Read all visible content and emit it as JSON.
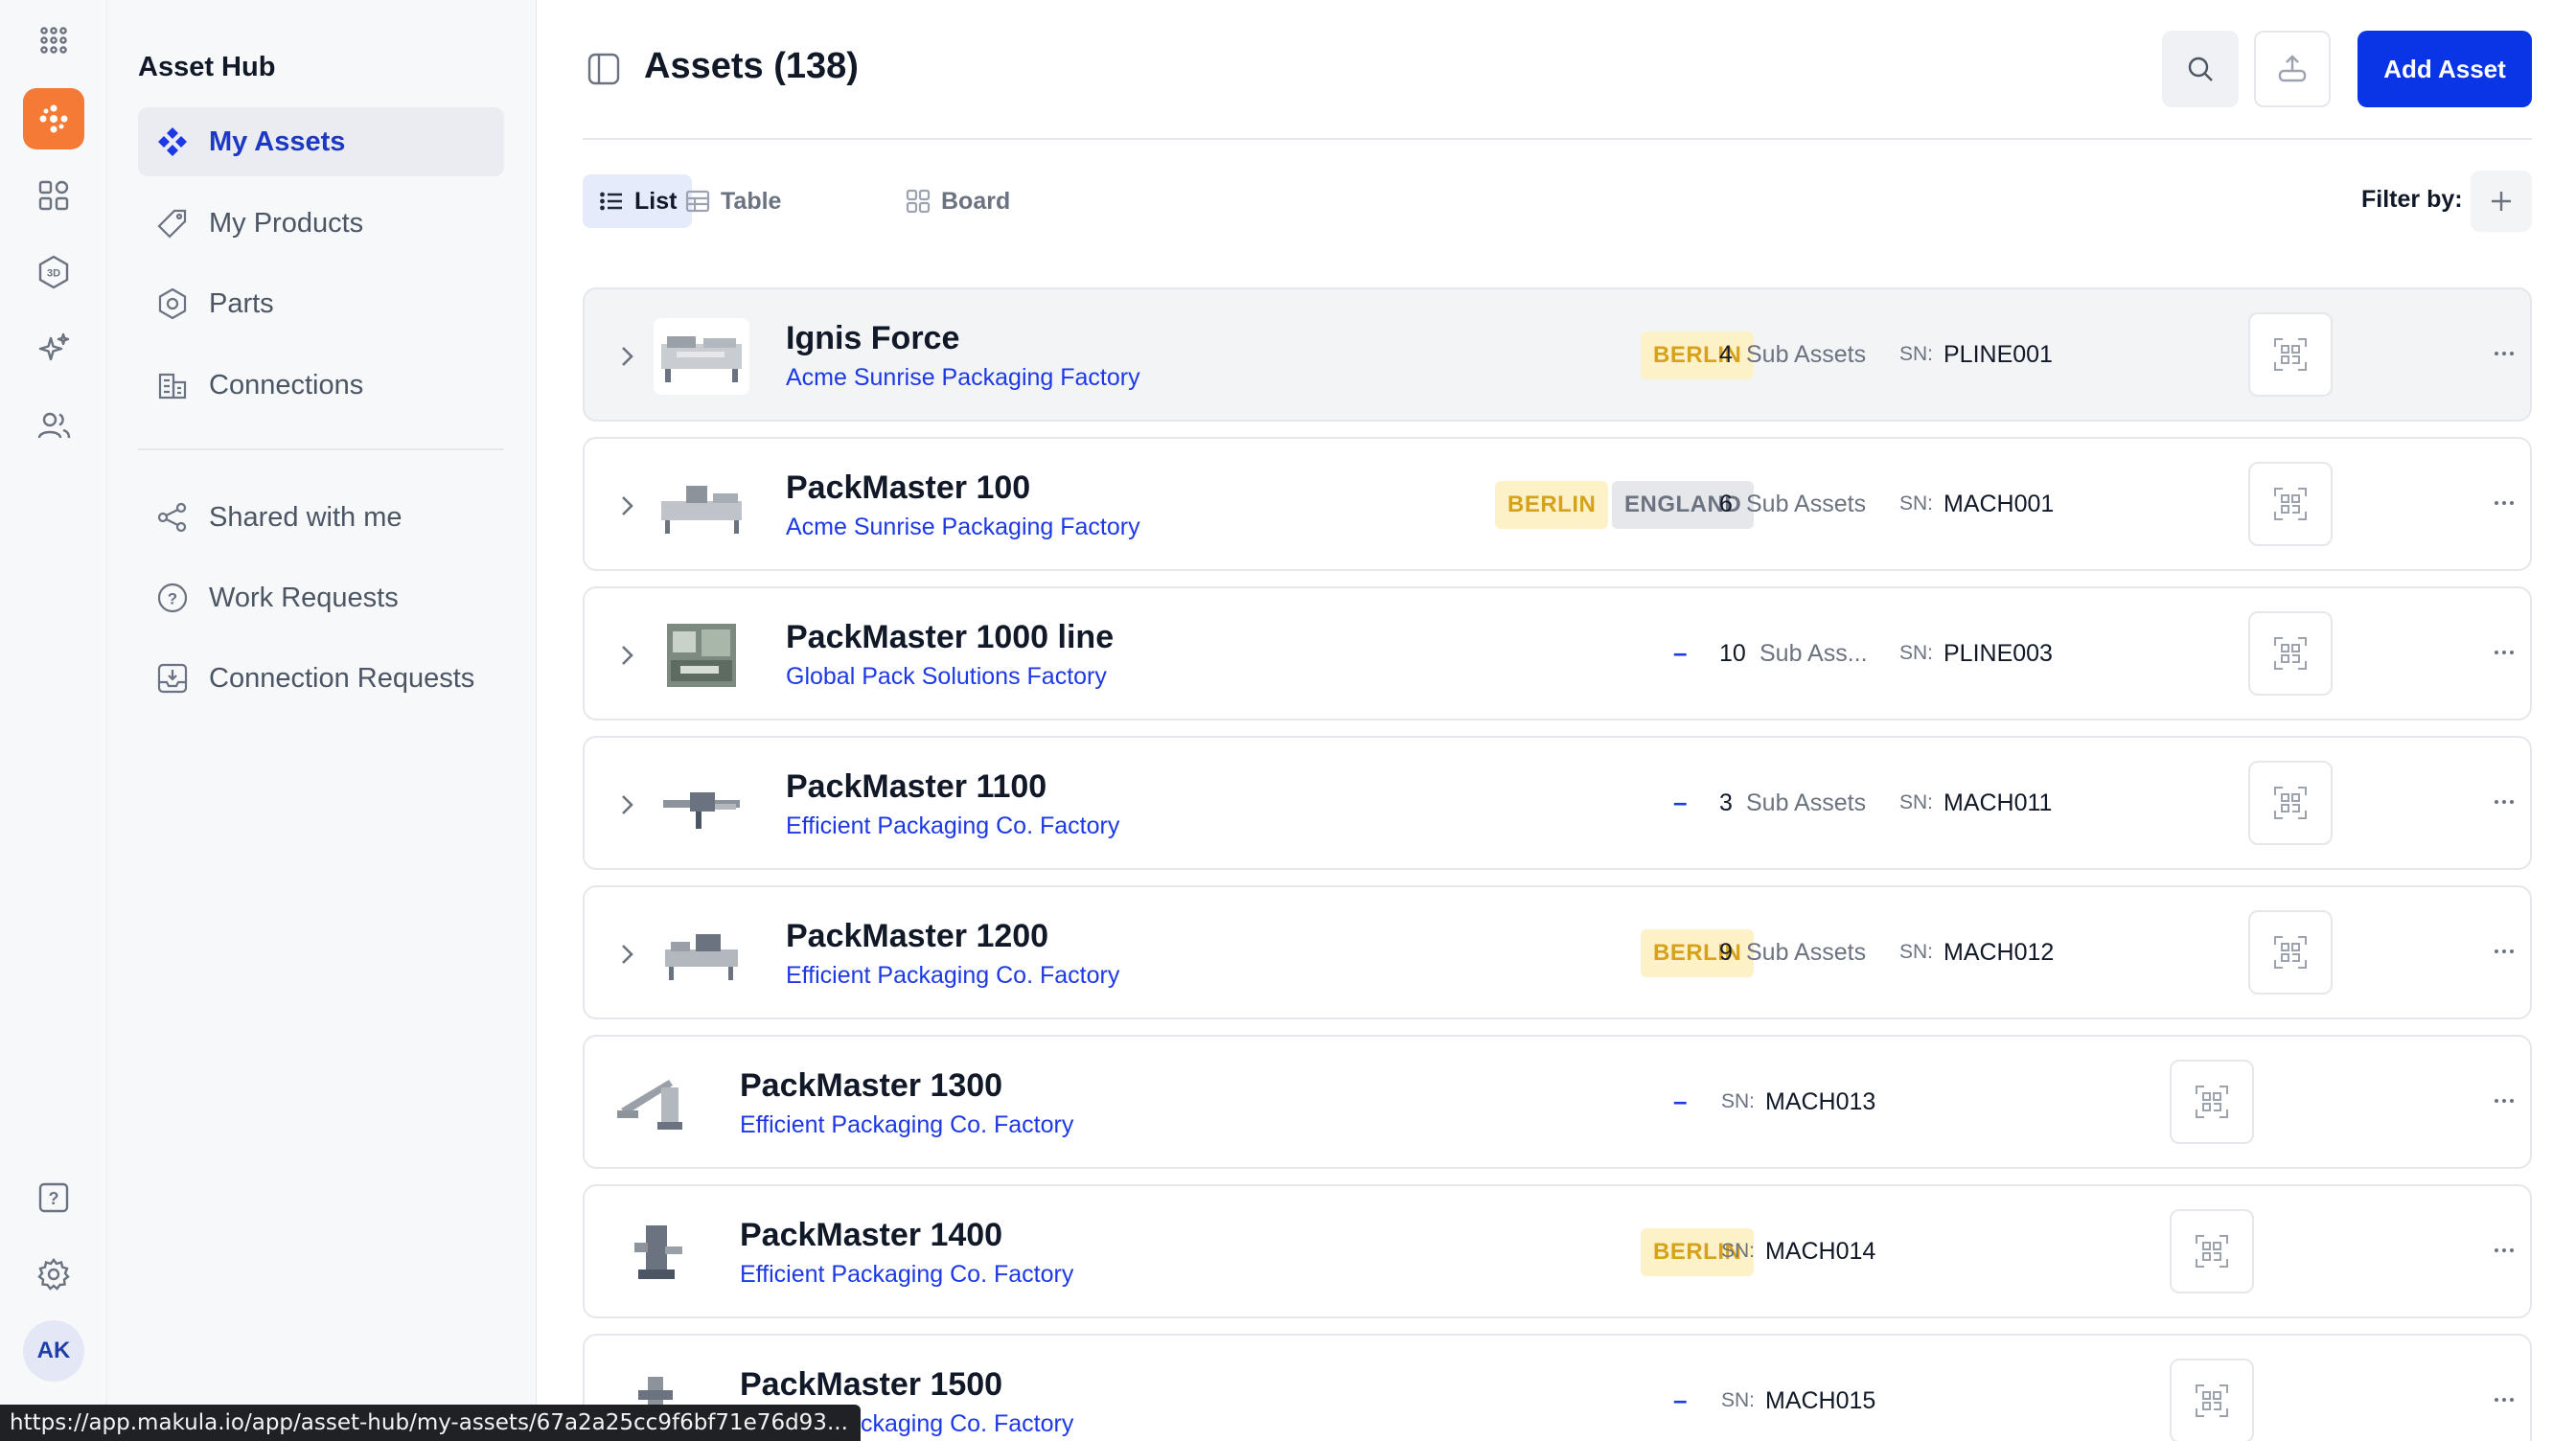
{
  "rail": {
    "items": [
      "apps-grid-icon",
      "asset-hub-icon",
      "widgets-icon",
      "3d-icon",
      "sparkles-icon",
      "users-icon",
      "help-icon",
      "settings-icon"
    ],
    "avatar": "AK",
    "accent": "#f47a36"
  },
  "sidebar": {
    "title": "Asset Hub",
    "items": [
      {
        "label": "My Assets",
        "icon": "diamonds-icon",
        "active": true
      },
      {
        "label": "My Products",
        "icon": "tag-icon"
      },
      {
        "label": "Parts",
        "icon": "hexagon-icon"
      },
      {
        "label": "Connections",
        "icon": "building-icon"
      },
      {
        "label": "Shared with me",
        "icon": "share-icon"
      },
      {
        "label": "Work Requests",
        "icon": "question-icon"
      },
      {
        "label": "Connection Requests",
        "icon": "inbox-icon"
      }
    ]
  },
  "header": {
    "title": "Assets (138)",
    "add_label": "Add Asset",
    "accent": "#0a35e6"
  },
  "views": {
    "tabs": [
      "List",
      "Table",
      "Board"
    ],
    "active": "List",
    "filter_label": "Filter by:"
  },
  "assets": [
    {
      "name": "Ignis Force",
      "location": "Acme Sunrise Packaging Factory",
      "badges": [
        "BERLIN"
      ],
      "sub_count": "4",
      "sub_label": "Sub Assets",
      "sn_label": "SN:",
      "sn": "PLINE001",
      "expandable": true
    },
    {
      "name": "PackMaster 100",
      "location": "Acme Sunrise Packaging Factory",
      "badges": [
        "BERLIN",
        "ENGLAND"
      ],
      "sub_count": "6",
      "sub_label": "Sub Assets",
      "sn_label": "SN:",
      "sn": "MACH001",
      "expandable": true
    },
    {
      "name": "PackMaster 1000 line",
      "location": "Global Pack Solutions Factory",
      "dash": "–",
      "sub_count": "10",
      "sub_label": "Sub Ass...",
      "sn_label": "SN:",
      "sn": "PLINE003",
      "expandable": true
    },
    {
      "name": "PackMaster 1100",
      "location": "Efficient Packaging Co. Factory",
      "dash": "–",
      "sub_count": "3",
      "sub_label": "Sub Assets",
      "sn_label": "SN:",
      "sn": "MACH011",
      "expandable": true
    },
    {
      "name": "PackMaster 1200",
      "location": "Efficient Packaging Co. Factory",
      "badges": [
        "BERLIN"
      ],
      "sub_count": "9",
      "sub_label": "Sub Assets",
      "sn_label": "SN:",
      "sn": "MACH012",
      "expandable": true
    },
    {
      "name": "PackMaster 1300",
      "location": "Efficient Packaging Co. Factory",
      "dash": "–",
      "sn_label": "SN:",
      "sn": "MACH013",
      "expandable": false
    },
    {
      "name": "PackMaster 1400",
      "location": "Efficient Packaging Co. Factory",
      "badges": [
        "BERLIN"
      ],
      "sn_label": "SN:",
      "sn": "MACH014",
      "expandable": false
    },
    {
      "name": "PackMaster 1500",
      "location": "Efficient Packaging Co. Factory",
      "dash": "–",
      "sn_label": "SN:",
      "sn": "MACH015",
      "expandable": false
    }
  ],
  "status_bar": {
    "url": "https://app.makula.io/app/asset-hub/my-assets/67a2a25cc9f6bf71e76d93..."
  }
}
